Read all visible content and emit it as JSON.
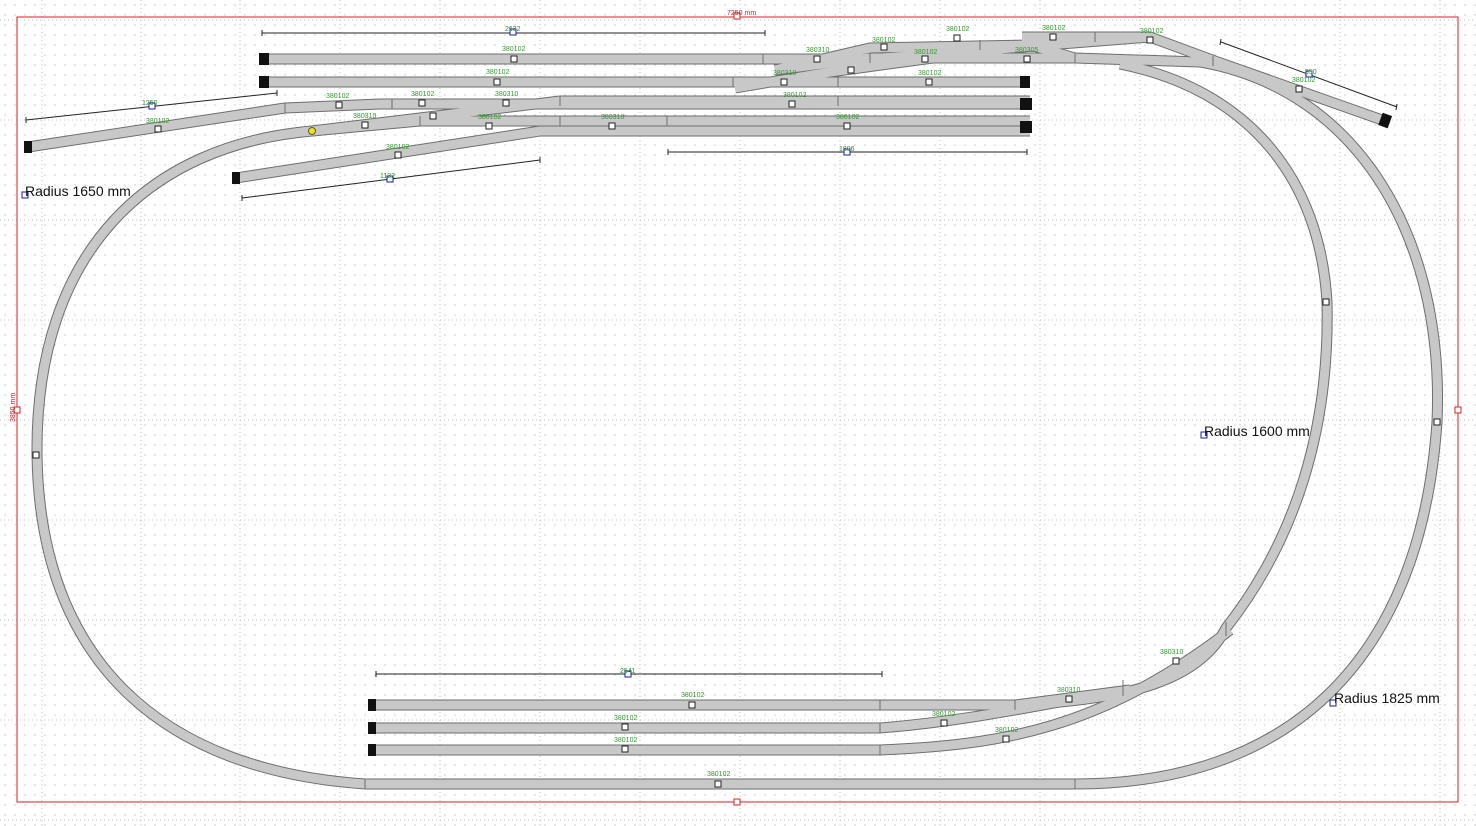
{
  "board": {
    "width_label": "7250 mm",
    "depth_label": "3850 mm"
  },
  "radius_labels": {
    "left": "Radius 1650 mm",
    "right_inner": "Radius 1600 mm",
    "right_outer": "Radius 1825 mm"
  },
  "dimensions": {
    "top": "2632",
    "right_diag": "950",
    "left_diag": "1250",
    "left_short": "1132",
    "yard_top": "1896",
    "bottom": "2541"
  },
  "part_labels": {
    "top1": "380102",
    "top2": "380102",
    "top3a": "380102",
    "top3b": "380102",
    "top3c": "380310",
    "top4a": "380102",
    "top4b": "380102",
    "left_diag": "380102",
    "left_sw": "380310",
    "short_branch": "380102",
    "yard3": "380102",
    "yard4a": "380102",
    "yard4b": "380318",
    "yard4c": "380102",
    "sw1": "380310",
    "sw2": "380310",
    "cv1": "380102",
    "cv2": "380102",
    "cv3": "380102",
    "cv4": "380102",
    "cv5": "380305",
    "diag_r": "380102",
    "mid3": "380102",
    "yb1": "380102",
    "yb2": "380102",
    "yb3": "380102",
    "yb_sw1": "380310",
    "yb_sw2": "380102",
    "yb_sw3": "380102",
    "bottom": "380102",
    "curve_r": "380310"
  },
  "colors": {
    "track": "#c8c8c8",
    "track_edge": "#6e6e6e",
    "grid": "#9a9a9a",
    "board": "#d62020",
    "dim": "#222222",
    "label": "#339933",
    "handle": "#1a1aaa"
  }
}
